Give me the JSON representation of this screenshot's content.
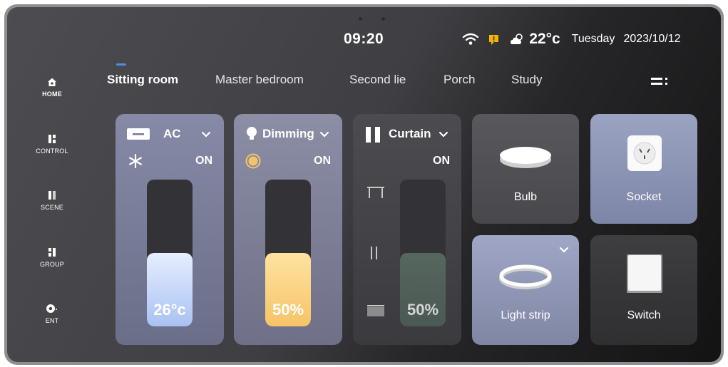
{
  "status_bar": {
    "time": "09:20",
    "temperature": "22°c",
    "day": "Tuesday",
    "date": "2023/10/12",
    "icons": [
      "wifi-icon",
      "alert-icon",
      "partly-cloudy-icon"
    ]
  },
  "sidebar": {
    "items": [
      {
        "label": "HOME",
        "icon": "home-icon"
      },
      {
        "label": "CONTROL",
        "icon": "control-icon"
      },
      {
        "label": "SCENE",
        "icon": "scene-icon"
      },
      {
        "label": "GROUP",
        "icon": "group-icon"
      },
      {
        "label": "ENT",
        "icon": "entertainment-icon"
      }
    ]
  },
  "tabs": {
    "active": "Sitting room",
    "items": [
      "Sitting room",
      "Master bedroom",
      "Second lie",
      "Porch",
      "Study"
    ]
  },
  "cards": {
    "ac": {
      "title": "AC",
      "state": "ON",
      "value": "26°c",
      "level": 0.5
    },
    "dimming": {
      "title": "Dimming",
      "state": "ON",
      "value": "50%",
      "level": 0.5
    },
    "curtain": {
      "title": "Curtain",
      "state": "ON",
      "value": "50%",
      "level": 0.5
    },
    "bulb": {
      "label": "Bulb"
    },
    "socket": {
      "label": "Socket"
    },
    "light_strip": {
      "label": "Light strip"
    },
    "switch": {
      "label": "Switch"
    }
  },
  "colors": {
    "accent": "#4a90e2",
    "alert": "#f5b400",
    "dimming_fill": "#f6c468",
    "ac_fill": "#a9c2f2"
  }
}
